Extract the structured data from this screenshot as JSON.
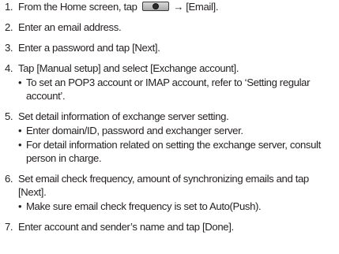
{
  "steps": [
    {
      "num": "1.",
      "pre": "From the Home screen, tap",
      "icon": "menu-key-icon",
      "post": "→ [Email].",
      "subs": []
    },
    {
      "num": "2.",
      "text": "Enter an email address.",
      "subs": []
    },
    {
      "num": "3.",
      "text": "Enter a password and tap [Next].",
      "subs": []
    },
    {
      "num": "4.",
      "text": "Tap [Manual setup] and select [Exchange account].",
      "subs": [
        "To set an POP3 account or IMAP account, refer to ‘Setting regular account’."
      ]
    },
    {
      "num": "5.",
      "text": "Set detail information of exchange server setting.",
      "subs": [
        "Enter domain/ID, password and exchanger server.",
        "For detail information related on setting the exchange server, consult person in charge."
      ]
    },
    {
      "num": "6.",
      "text": "Set email check frequency, amount of synchronizing emails and tap [Next].",
      "subs": [
        "Make sure email check frequency is set to Auto(Push)."
      ]
    },
    {
      "num": "7.",
      "text": "Enter account and sender’s name and tap [Done].",
      "subs": []
    }
  ],
  "bullet_glyph": "•"
}
